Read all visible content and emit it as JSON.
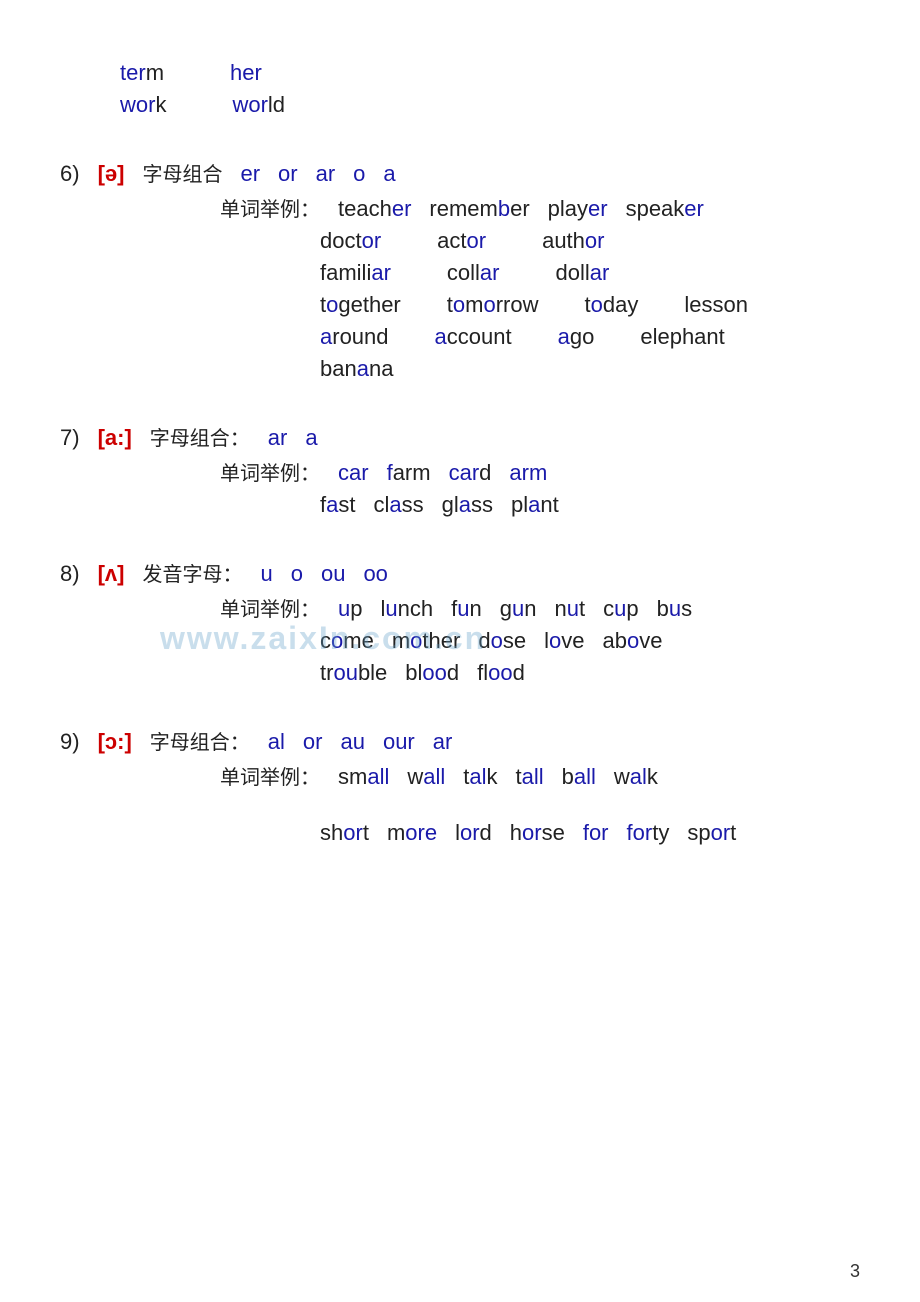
{
  "page": {
    "page_number": "3",
    "watermark": "www.zaixIn.com.cn"
  },
  "top_section": {
    "line1": [
      "term",
      "her"
    ],
    "line2": [
      "work",
      "world"
    ]
  },
  "sections": [
    {
      "id": "section6",
      "num": "6)",
      "phonetic": "[ə]",
      "zi_label": "字母组合",
      "letters": [
        "er",
        "or",
        "ar",
        "o",
        "a"
      ],
      "example_label": "单词举例：",
      "examples": [
        {
          "word": "teacher",
          "hl_indices": [
            5,
            6
          ]
        },
        {
          "word": "remember",
          "hl_indices": [
            5,
            6,
            7
          ]
        },
        {
          "word": "player",
          "hl_indices": [
            4,
            5
          ]
        },
        {
          "word": "speaker",
          "hl_indices": [
            5,
            6
          ]
        },
        {
          "word": "doctor",
          "hl_indices": [
            4,
            5
          ]
        },
        {
          "word": "actor",
          "hl_indices": [
            3,
            4
          ]
        },
        {
          "word": "author",
          "hl_indices": [
            4,
            5
          ]
        },
        {
          "word": "familiar",
          "hl_indices": [
            6,
            7
          ]
        },
        {
          "word": "collar",
          "hl_indices": [
            4,
            5
          ]
        },
        {
          "word": "dollar",
          "hl_indices": [
            4,
            5
          ]
        },
        {
          "word": "together",
          "hl_indices": [
            1,
            6,
            7
          ]
        },
        {
          "word": "tomorrow",
          "hl_indices": [
            1,
            5
          ]
        },
        {
          "word": "today",
          "hl_indices": [
            1
          ]
        },
        {
          "word": "lesson",
          "hl_indices": []
        },
        {
          "word": "around",
          "hl_indices": [
            0
          ]
        },
        {
          "word": "account",
          "hl_indices": [
            0
          ]
        },
        {
          "word": "ago",
          "hl_indices": [
            0
          ]
        },
        {
          "word": "elephant",
          "hl_indices": []
        },
        {
          "word": "banana",
          "hl_indices": [
            4
          ]
        }
      ],
      "rows": [
        [
          "teacher",
          "remember",
          "player",
          "speaker"
        ],
        [
          "doctor",
          "actor",
          "author"
        ],
        [
          "familiar",
          "collar",
          "dollar"
        ],
        [
          "together",
          "tomorrow",
          "today",
          "lesson"
        ],
        [
          "around",
          "account",
          "ago",
          "elephant"
        ],
        [
          "banana"
        ]
      ]
    },
    {
      "id": "section7",
      "num": "7)",
      "phonetic": "[a:]",
      "zi_label": "字母组合：",
      "letters": [
        "ar",
        "a"
      ],
      "example_label": "单词举例：",
      "rows": [
        [
          "car",
          "farm",
          "card",
          "arm"
        ],
        [
          "fast",
          "class",
          "glass",
          "plant"
        ]
      ]
    },
    {
      "id": "section8",
      "num": "8)",
      "phonetic": "[ʌ]",
      "zi_label": "发音字母：",
      "letters": [
        "u",
        "o",
        "ou",
        "oo"
      ],
      "example_label": "单词举例：",
      "rows": [
        [
          "up",
          "lunch",
          "fun",
          "gun",
          "nut",
          "cup",
          "bus"
        ],
        [
          "come",
          "mother",
          "dose",
          "love",
          "above"
        ],
        [
          "trouble",
          "blood",
          "flood"
        ]
      ]
    },
    {
      "id": "section9",
      "num": "9)",
      "phonetic": "[ɔ:]",
      "zi_label": "字母组合：",
      "letters": [
        "al",
        "or",
        "au",
        "our",
        "ar"
      ],
      "example_label": "单词举例：",
      "rows": [
        [
          "small",
          "wall",
          "talk",
          "tall",
          "ball",
          "walk"
        ],
        [],
        [
          "short",
          "more",
          "lord",
          "horse",
          "for",
          "forty",
          "sport"
        ]
      ]
    }
  ]
}
